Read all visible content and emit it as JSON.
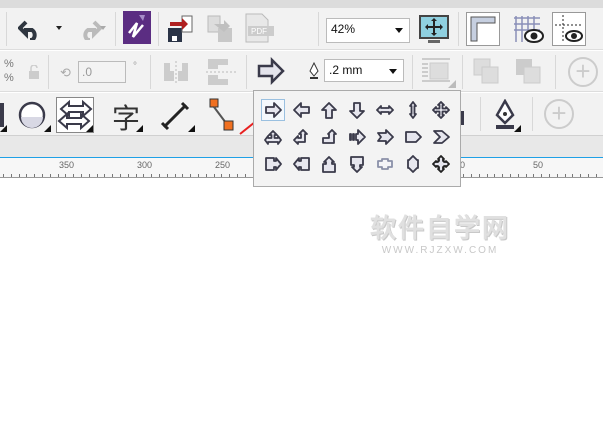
{
  "toolbar": {
    "zoom_value": "42%",
    "rotation_value": ".0",
    "rotation_unit": "°",
    "percent_top": "%",
    "percent_bottom": "%",
    "outline_width": ".2 mm",
    "text_tool_glyph": "字"
  },
  "arrow_popup": {
    "rows": [
      [
        "right-arrow",
        "left-arrow",
        "up-arrow",
        "down-arrow",
        "left-right-arrow",
        "up-down-arrow",
        "four-way-arrow"
      ],
      [
        "left-right-up-arrow",
        "up-left-arrow",
        "bent-up-arrow",
        "striped-right-arrow",
        "notched-right-arrow",
        "pentagon-arrow",
        "chevron-arrow"
      ],
      [
        "right-callout-arrow",
        "left-callout-arrow",
        "up-callout-arrow",
        "down-callout-arrow",
        "cross-callout-arrow",
        "up-down-callout-arrow",
        "four-way-callout-arrow"
      ]
    ],
    "selected": "right-arrow"
  },
  "ruler": {
    "labels": [
      "350",
      "300",
      "250",
      "0",
      "50"
    ]
  },
  "watermark": {
    "title": "软件自学网",
    "url": "WWW.RJZXW.COM"
  },
  "colors": {
    "accent_blue": "#1ea0e6",
    "annotation_red": "#e82020",
    "coreldraw_purple": "#5b2d82"
  }
}
